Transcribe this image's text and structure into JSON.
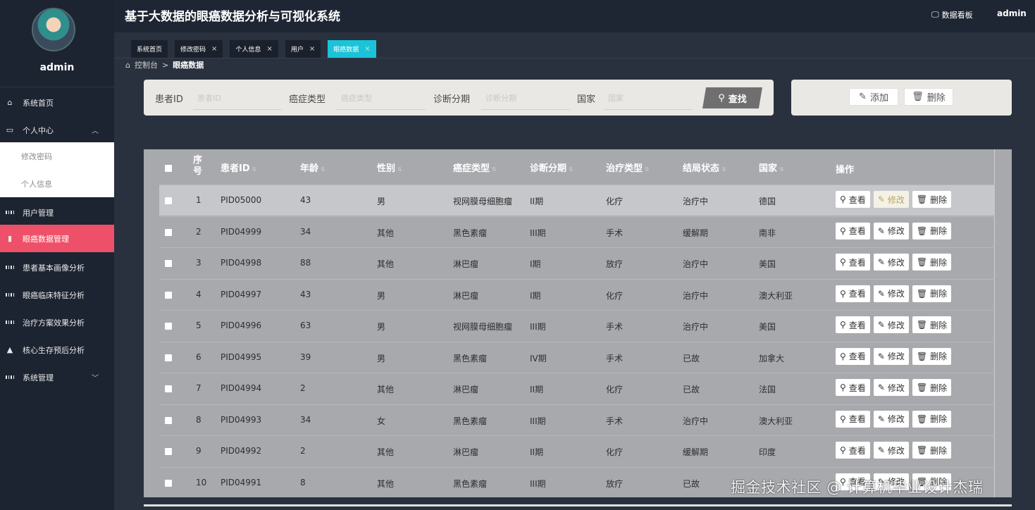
{
  "header": {
    "title": "基于大数据的眼癌数据分析与可视化系统",
    "dashboard": "数据看板",
    "user": "admin",
    "icons": {
      "dashboard": "monitor-icon"
    }
  },
  "sidebar": {
    "username": "admin",
    "items": [
      {
        "label": "系统首页",
        "icon": "home-icon"
      },
      {
        "label": "个人中心",
        "icon": "user-card-icon",
        "expanded": true
      },
      {
        "label": "用户管理",
        "icon": "grid-icon"
      },
      {
        "label": "眼癌数据管理",
        "icon": "book-icon",
        "active": true
      },
      {
        "label": "患者基本画像分析",
        "icon": "grid-icon"
      },
      {
        "label": "眼癌临床特征分析",
        "icon": "grid-icon"
      },
      {
        "label": "治疗方案效果分析",
        "icon": "grid-icon"
      },
      {
        "label": "核心生存预后分析",
        "icon": "chart-icon"
      },
      {
        "label": "系统管理",
        "icon": "grid-icon"
      }
    ],
    "subitems": [
      "修改密码",
      "个人信息"
    ]
  },
  "tabs": [
    {
      "label": "系统首页",
      "closable": false
    },
    {
      "label": "修改密码",
      "closable": true
    },
    {
      "label": "个人信息",
      "closable": true
    },
    {
      "label": "用户",
      "closable": true
    },
    {
      "label": "眼癌数据",
      "closable": true,
      "active": true
    }
  ],
  "tab_close": "×",
  "breadcrumb": {
    "home": "控制台",
    "sep": ">",
    "current": "眼癌数据"
  },
  "search": {
    "fields": [
      {
        "label": "患者ID",
        "placeholder": "患者ID"
      },
      {
        "label": "癌症类型",
        "placeholder": "癌症类型"
      },
      {
        "label": "诊断分期",
        "placeholder": "诊断分期"
      },
      {
        "label": "国家",
        "placeholder": "国家"
      }
    ],
    "find_label": "查找"
  },
  "actions": {
    "add": "添加",
    "delete": "删除"
  },
  "table": {
    "headers": [
      "序号",
      "患者ID",
      "年龄",
      "性别",
      "癌症类型",
      "诊断分期",
      "治疗类型",
      "结局状态",
      "国家",
      "操作"
    ],
    "ops": {
      "view": "查看",
      "edit": "修改",
      "delete": "删除"
    },
    "rows": [
      [
        "1",
        "PID05000",
        "43",
        "男",
        "视网膜母细胞瘤",
        "II期",
        "化疗",
        "治疗中",
        "德国"
      ],
      [
        "2",
        "PID04999",
        "34",
        "其他",
        "黑色素瘤",
        "III期",
        "手术",
        "缓解期",
        "南非"
      ],
      [
        "3",
        "PID04998",
        "88",
        "其他",
        "淋巴瘤",
        "I期",
        "放疗",
        "治疗中",
        "美国"
      ],
      [
        "4",
        "PID04997",
        "43",
        "男",
        "淋巴瘤",
        "I期",
        "化疗",
        "治疗中",
        "澳大利亚"
      ],
      [
        "5",
        "PID04996",
        "63",
        "男",
        "视网膜母细胞瘤",
        "III期",
        "手术",
        "治疗中",
        "美国"
      ],
      [
        "6",
        "PID04995",
        "39",
        "男",
        "黑色素瘤",
        "IV期",
        "手术",
        "已故",
        "加拿大"
      ],
      [
        "7",
        "PID04994",
        "2",
        "其他",
        "淋巴瘤",
        "II期",
        "化疗",
        "已故",
        "法国"
      ],
      [
        "8",
        "PID04993",
        "34",
        "女",
        "黑色素瘤",
        "III期",
        "手术",
        "治疗中",
        "澳大利亚"
      ],
      [
        "9",
        "PID04992",
        "2",
        "其他",
        "淋巴瘤",
        "II期",
        "化疗",
        "缓解期",
        "印度"
      ],
      [
        "10",
        "PID04991",
        "8",
        "其他",
        "黑色素瘤",
        "III期",
        "放疗",
        "已故",
        ""
      ]
    ]
  },
  "watermark": "掘金技术社区 @ 计算机毕业设计杰瑞"
}
